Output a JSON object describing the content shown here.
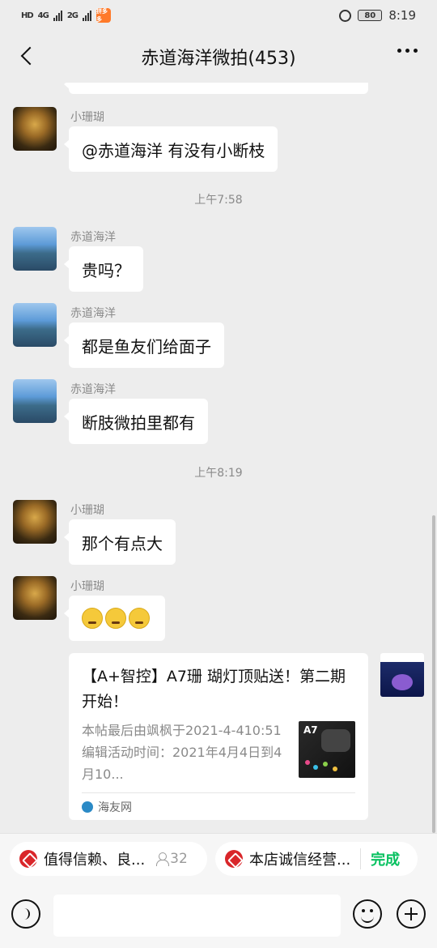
{
  "status_bar": {
    "network_labels": [
      "HD",
      "4G",
      "2G"
    ],
    "app_badge": "拼多多",
    "battery": "80",
    "time": "8:19"
  },
  "header": {
    "title": "赤道海洋微拍(453)"
  },
  "messages": [
    {
      "type": "text",
      "sender": "小珊瑚",
      "text": "@赤道海洋  有没有小断枝"
    },
    {
      "type": "time",
      "text": "上午7:58"
    },
    {
      "type": "text",
      "sender": "赤道海洋",
      "text": "贵吗？"
    },
    {
      "type": "text",
      "sender": "赤道海洋",
      "text": "都是鱼友们给面子"
    },
    {
      "type": "text",
      "sender": "赤道海洋",
      "text": "断肢微拍里都有"
    },
    {
      "type": "time",
      "text": "上午8:19"
    },
    {
      "type": "text",
      "sender": "小珊瑚",
      "text": "那个有点大"
    },
    {
      "type": "emoji",
      "sender": "小珊瑚",
      "emoji_name": "crying-emoji"
    }
  ],
  "link_card": {
    "title": "【A+智控】A7珊 瑚灯顶贴送！第二期开始！",
    "description": "本帖最后由飒枫于2021-4-410:51编辑活动时间：2021年4月4日到4月10...",
    "thumb_label": "A7",
    "source": "海友网"
  },
  "quick_bar": {
    "chip1_label": "值得信赖、良...",
    "chip1_count": "32",
    "chip2_label": "本店诚信经营...",
    "done_label": "完成"
  },
  "colors": {
    "accent_green": "#07c160",
    "chip_icon_red": "#d9262a"
  }
}
